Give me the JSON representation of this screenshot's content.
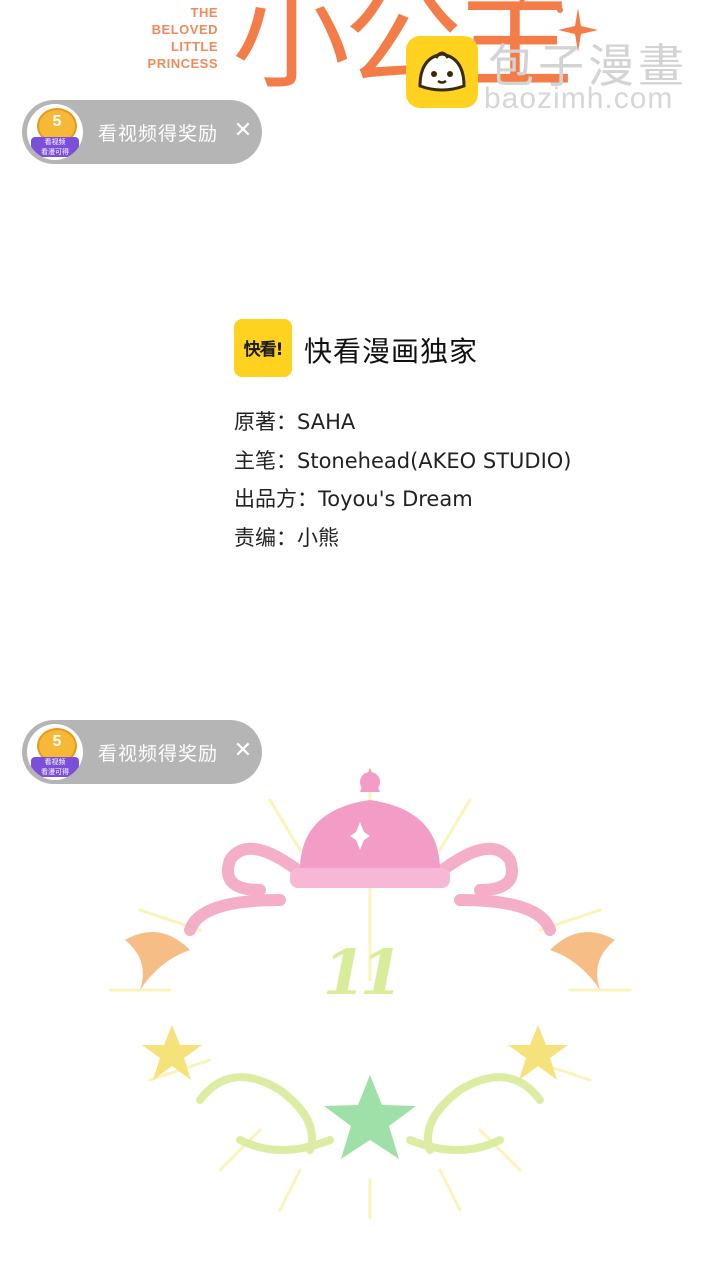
{
  "title_art": {
    "english_lines": [
      "THE",
      "BELOVED",
      "LITTLE",
      "PRINCESS"
    ],
    "chinese_fragment": "小公主"
  },
  "watermark": {
    "site_name": "包子漫畫",
    "site_url": "baozimh.com",
    "icon": "bun-mascot-icon"
  },
  "reward_pills": [
    {
      "coin_number": "5",
      "badge_line1": "看视频",
      "badge_line2": "看漫可得",
      "label": "看视频得奖励",
      "close": "✕"
    },
    {
      "coin_number": "5",
      "badge_line1": "看视频",
      "badge_line2": "看漫可得",
      "label": "看视频得奖励",
      "close": "✕"
    }
  ],
  "credits": {
    "logo_text": "快看!",
    "exclusive": "快看漫画独家",
    "lines": [
      "原著：SAHA",
      "主笔：Stonehead(AKEO STUDIO)",
      "出品方：Toyou's Dream",
      "责编：小熊"
    ]
  },
  "chapter": {
    "number": "11",
    "icons": [
      "crown-icon",
      "star-icon"
    ]
  },
  "colors": {
    "title_orange": "#f47c48",
    "logo_yellow": "#ffd21f",
    "pill_gray": "#b5b5b5",
    "crown_pink": "#f29cc6",
    "star_green": "#9ee0a8",
    "star_yellow": "#f5e27a"
  }
}
